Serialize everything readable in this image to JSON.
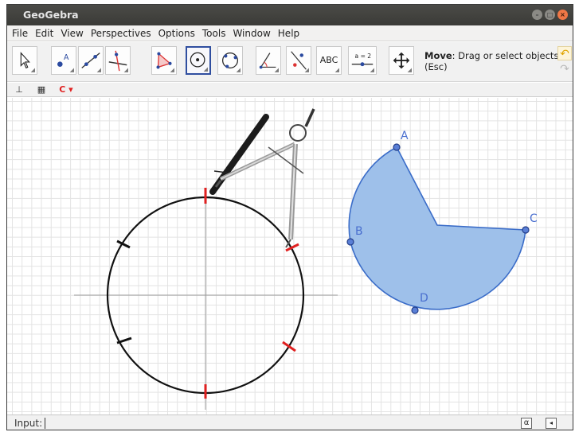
{
  "window": {
    "title": "GeoGebra",
    "minimize": "–",
    "maximize": "□",
    "close": "×"
  },
  "menu": [
    "File",
    "Edit",
    "View",
    "Perspectives",
    "Options",
    "Tools",
    "Window",
    "Help"
  ],
  "toolbar": {
    "text_tool_label": "ABC",
    "slider_tool_label": "a = 2",
    "help_title": "Move",
    "help_text": ": Drag or select objects (Esc)",
    "undo": "↶",
    "redo": "↷"
  },
  "stylebar": {
    "graphics_view_toggle": "⊥",
    "grid_toggle": "▦",
    "color_menu": "C ▾"
  },
  "points": [
    {
      "name": "A",
      "color": "#4a6fcf"
    },
    {
      "name": "B",
      "color": "#4a6fcf"
    },
    {
      "name": "C",
      "color": "#4a6fcf"
    },
    {
      "name": "D",
      "color": "#4a6fcf"
    }
  ],
  "colors": {
    "sector_fill": "#9ec0ea",
    "sector_stroke": "#3a6cc8",
    "mark_red": "#e02020",
    "mark_black": "#111111"
  },
  "input": {
    "label": "Input:",
    "value": "",
    "alpha": "α",
    "keyboard": "◂"
  }
}
